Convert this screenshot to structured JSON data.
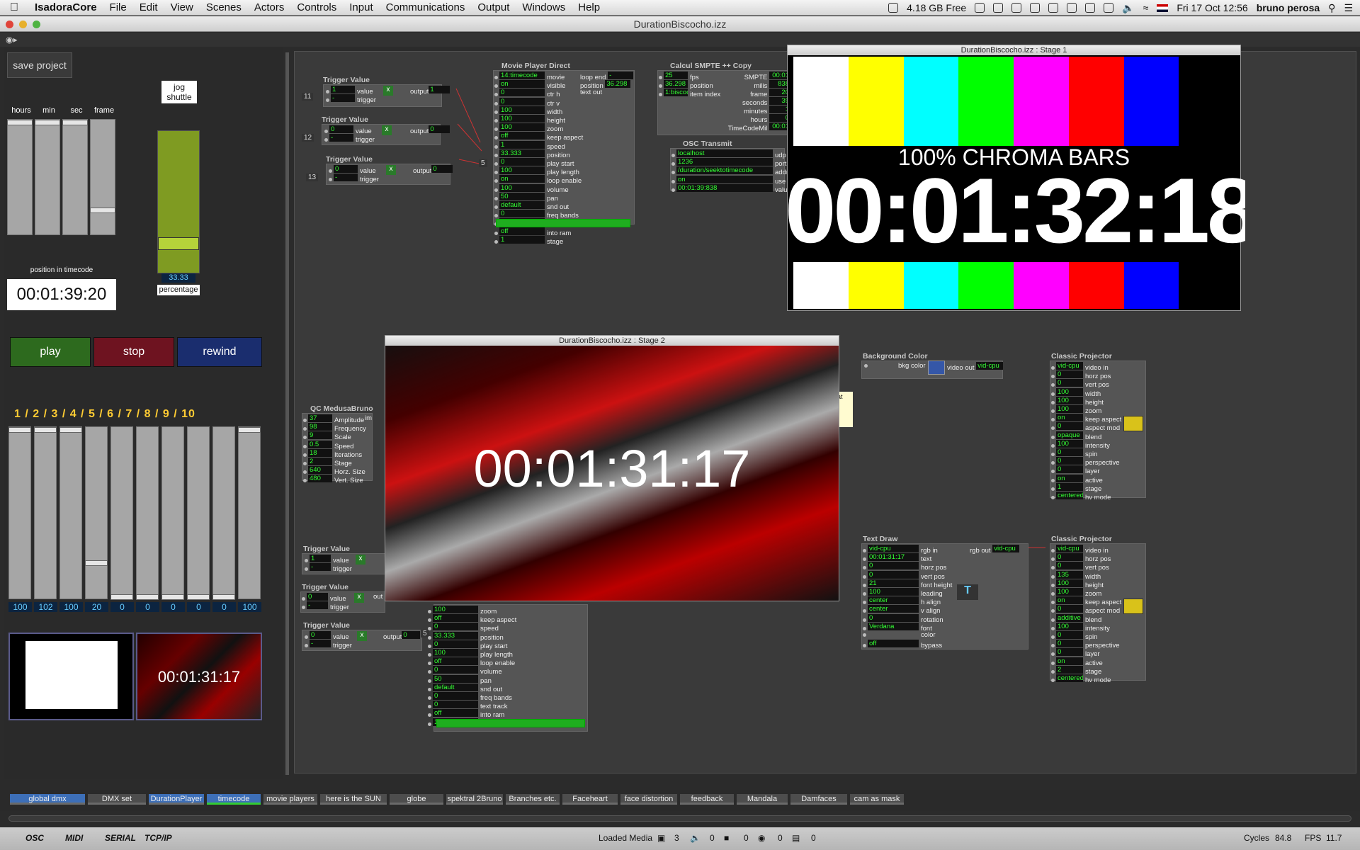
{
  "menubar": {
    "app": "IsadoraCore",
    "items": [
      "File",
      "Edit",
      "View",
      "Scenes",
      "Actors",
      "Controls",
      "Input",
      "Communications",
      "Output",
      "Windows",
      "Help"
    ],
    "memory": "4.18 GB Free",
    "lang": "Fri",
    "datetime": "Fri 17 Oct  12:56",
    "user": "bruno perosa"
  },
  "window_title": "DurationBiscocho.izz",
  "controls": {
    "save_project": "save project",
    "jog_shuttle": "jog\nshuttle",
    "fader_labels": [
      "hours",
      "min",
      "sec",
      "frame"
    ],
    "position_label": "position in timecode",
    "timecode": "00:01:39:20",
    "jog_value": "33.33",
    "percentage": "percentage",
    "play": "play",
    "stop": "stop",
    "rewind": "rewind",
    "channel_header": "1 / 2 / 3 / 4 / 5 / 6 / 7 / 8 / 9 / 10",
    "channel_values": [
      "100",
      "102",
      "100",
      "20",
      "0",
      "0",
      "0",
      "0",
      "0",
      "100"
    ],
    "preview_timecode": "00:01:31:17"
  },
  "actors": {
    "trigger1": {
      "title": "Trigger Value",
      "value": "1",
      "in": "value",
      "trig": "trigger",
      "out": "output",
      "outv": "1",
      "num": "11"
    },
    "trigger2": {
      "title": "Trigger Value",
      "value": "0",
      "in": "value",
      "trig": "trigger",
      "out": "output",
      "outv": "0",
      "num": "12"
    },
    "trigger3": {
      "title": "Trigger Value",
      "value": "0",
      "in": "value",
      "trig": "trigger",
      "out": "output",
      "outv": "0",
      "num": "13"
    },
    "trigger4": {
      "title": "Trigger Value",
      "value": "1",
      "in": "value",
      "trig": "trigger",
      "out": "output"
    },
    "trigger5": {
      "title": "Trigger Value",
      "value": "0",
      "in": "value",
      "trig": "trigger",
      "out": "out"
    },
    "trigger6": {
      "title": "Trigger Value",
      "value": "0",
      "in": "value",
      "trig": "trigger",
      "out": "output",
      "outv": "0"
    },
    "movie": {
      "title": "Movie Player Direct",
      "rows": [
        [
          "14:timecode",
          "movie"
        ],
        [
          "on",
          "visible"
        ],
        [
          "0",
          "ctr h"
        ],
        [
          "0",
          "ctr v"
        ],
        [
          "100",
          "width"
        ],
        [
          "100",
          "height"
        ],
        [
          "100",
          "zoom"
        ],
        [
          "off",
          "keep aspect"
        ],
        [
          "1",
          "speed"
        ],
        [
          "33.333",
          "position"
        ],
        [
          "0",
          "play start"
        ],
        [
          "100",
          "play length"
        ],
        [
          "on",
          "loop enable"
        ],
        [
          "100",
          "volume"
        ],
        [
          "50",
          "pan"
        ],
        [
          "default",
          "snd out"
        ],
        [
          "0",
          "freq bands"
        ],
        [
          "0",
          "text track"
        ],
        [
          "off",
          "into ram"
        ],
        [
          "1",
          "stage"
        ]
      ],
      "outs": [
        [
          "loop end",
          "-"
        ],
        [
          "position",
          "36.298"
        ],
        [
          "text out",
          ""
        ]
      ]
    },
    "smpte": {
      "title": "Calcul SMPTE ++ Copy",
      "ins": [
        [
          "25",
          "fps"
        ],
        [
          "36.298",
          "position"
        ],
        [
          "1:biscoc",
          "item index"
        ]
      ],
      "outs": [
        [
          "SMPTE",
          "00:01"
        ],
        [
          "milis",
          "838"
        ],
        [
          "frame",
          "20"
        ],
        [
          "seconds",
          "39"
        ],
        [
          "minutes",
          "1"
        ],
        [
          "hours",
          "0"
        ],
        [
          "TimeCodeMil",
          "00:01"
        ]
      ]
    },
    "osc": {
      "title": "OSC Transmit",
      "rows": [
        [
          "localhost",
          "udp"
        ],
        [
          "1236",
          "port"
        ],
        [
          "/duration/seektotimecode",
          "addr"
        ],
        [
          "on",
          "use"
        ],
        [
          "00:01:39:838",
          "valu"
        ]
      ]
    },
    "medusa": {
      "title": "QC MedusaBruno",
      "rows": [
        [
          "37",
          "Amplitude"
        ],
        [
          "98",
          "Frequency"
        ],
        [
          "9",
          "Scale"
        ],
        [
          "0.5",
          "Speed"
        ],
        [
          "18",
          "Iterations"
        ],
        [
          "2",
          "Stage"
        ],
        [
          "640",
          "Horz. Size"
        ],
        [
          "480",
          "Vert. Size"
        ]
      ],
      "out": "im"
    },
    "movie2": {
      "rows": [
        [
          "100",
          "zoom"
        ],
        [
          "off",
          "keep aspect"
        ],
        [
          "0",
          "speed"
        ],
        [
          "33.333",
          "position"
        ],
        [
          "0",
          "play start"
        ],
        [
          "100",
          "play length"
        ],
        [
          "off",
          "loop enable"
        ],
        [
          "0",
          "volume"
        ],
        [
          "50",
          "pan"
        ],
        [
          "default",
          "snd out"
        ],
        [
          "0",
          "freq bands"
        ],
        [
          "0",
          "text track"
        ],
        [
          "off",
          "into ram"
        ],
        [
          "1",
          "stage"
        ]
      ],
      "num": "5"
    },
    "bgcolor": {
      "title": "Background Color",
      "in": "bkg color",
      "out": "video out",
      "outv": "vid-cpu"
    },
    "projector1": {
      "title": "Classic Projector",
      "rows": [
        [
          "vid-cpu",
          "video in"
        ],
        [
          "0",
          "horz pos"
        ],
        [
          "0",
          "vert pos"
        ],
        [
          "100",
          "width"
        ],
        [
          "100",
          "height"
        ],
        [
          "100",
          "zoom"
        ],
        [
          "on",
          "keep aspect"
        ],
        [
          "0",
          "aspect mod"
        ],
        [
          "opaque",
          "blend"
        ],
        [
          "100",
          "intensity"
        ],
        [
          "0",
          "spin"
        ],
        [
          "0",
          "perspective"
        ],
        [
          "0",
          "layer"
        ],
        [
          "on",
          "active"
        ],
        [
          "1",
          "stage"
        ],
        [
          "centered",
          "hv mode"
        ]
      ]
    },
    "textdraw": {
      "title": "Text Draw",
      "rows": [
        [
          "vid-cpu",
          "rgb in"
        ],
        [
          "00:01:31:17",
          "text"
        ],
        [
          "0",
          "horz pos"
        ],
        [
          "0",
          "vert pos"
        ],
        [
          "21",
          "font height"
        ],
        [
          "100",
          "leading"
        ],
        [
          "center",
          "h align"
        ],
        [
          "center",
          "v align"
        ],
        [
          "0",
          "rotation"
        ],
        [
          "Verdana",
          "font"
        ],
        [
          "",
          "color"
        ],
        [
          "off",
          "bypass"
        ]
      ],
      "out": "rgb out",
      "outv": "vid-cpu"
    },
    "projector2": {
      "title": "Classic Projector",
      "rows": [
        [
          "vid-cpu",
          "video in"
        ],
        [
          "0",
          "horz pos"
        ],
        [
          "0",
          "vert pos"
        ],
        [
          "135",
          "width"
        ],
        [
          "100",
          "height"
        ],
        [
          "100",
          "zoom"
        ],
        [
          "on",
          "keep aspect"
        ],
        [
          "0",
          "aspect mod"
        ],
        [
          "additive",
          "blend"
        ],
        [
          "100",
          "intensity"
        ],
        [
          "0",
          "spin"
        ],
        [
          "0",
          "perspective"
        ],
        [
          "0",
          "layer"
        ],
        [
          "on",
          "active"
        ],
        [
          "2",
          "stage"
        ],
        [
          "centered",
          "hv mode"
        ]
      ]
    },
    "comment_at": "at",
    "num5": "5"
  },
  "stage1": {
    "title": "DurationBiscocho.izz : Stage 1",
    "banner": "100% CHROMA BARS",
    "timecode": "00:01:32:18"
  },
  "stage2": {
    "title": "DurationBiscocho.izz : Stage 2",
    "timecode": "00:01:31:17"
  },
  "scenes": [
    {
      "label": "global dmx",
      "active": true
    },
    {
      "label": "DMX set"
    },
    {
      "label": "DurationPlayer",
      "active": true
    },
    {
      "label": "timecode",
      "active": true,
      "current": true
    },
    {
      "label": "movie players"
    },
    {
      "label": "here is the SUN"
    },
    {
      "label": "globe"
    },
    {
      "label": "spektral 2Bruno"
    },
    {
      "label": "Branches etc."
    },
    {
      "label": "Faceheart"
    },
    {
      "label": "face distortion"
    },
    {
      "label": "feedback"
    },
    {
      "label": "Mandala"
    },
    {
      "label": "Damfaces"
    },
    {
      "label": "cam as mask"
    }
  ],
  "status": {
    "osc": "OSC",
    "midi": "MIDI",
    "serial": "SERIAL",
    "tcpip": "TCP/IP",
    "loaded": "Loaded Media",
    "counts": [
      "3",
      "0",
      "0",
      "0",
      "0"
    ],
    "cycles_label": "Cycles",
    "cycles": "84.8",
    "fps_label": "FPS",
    "fps": "11.7"
  },
  "colors": {
    "play": "#2d6a1e",
    "stop": "#6e1320",
    "rewind": "#1a2d6e",
    "jog": "#8aa627",
    "value_text": "#33ff33"
  }
}
